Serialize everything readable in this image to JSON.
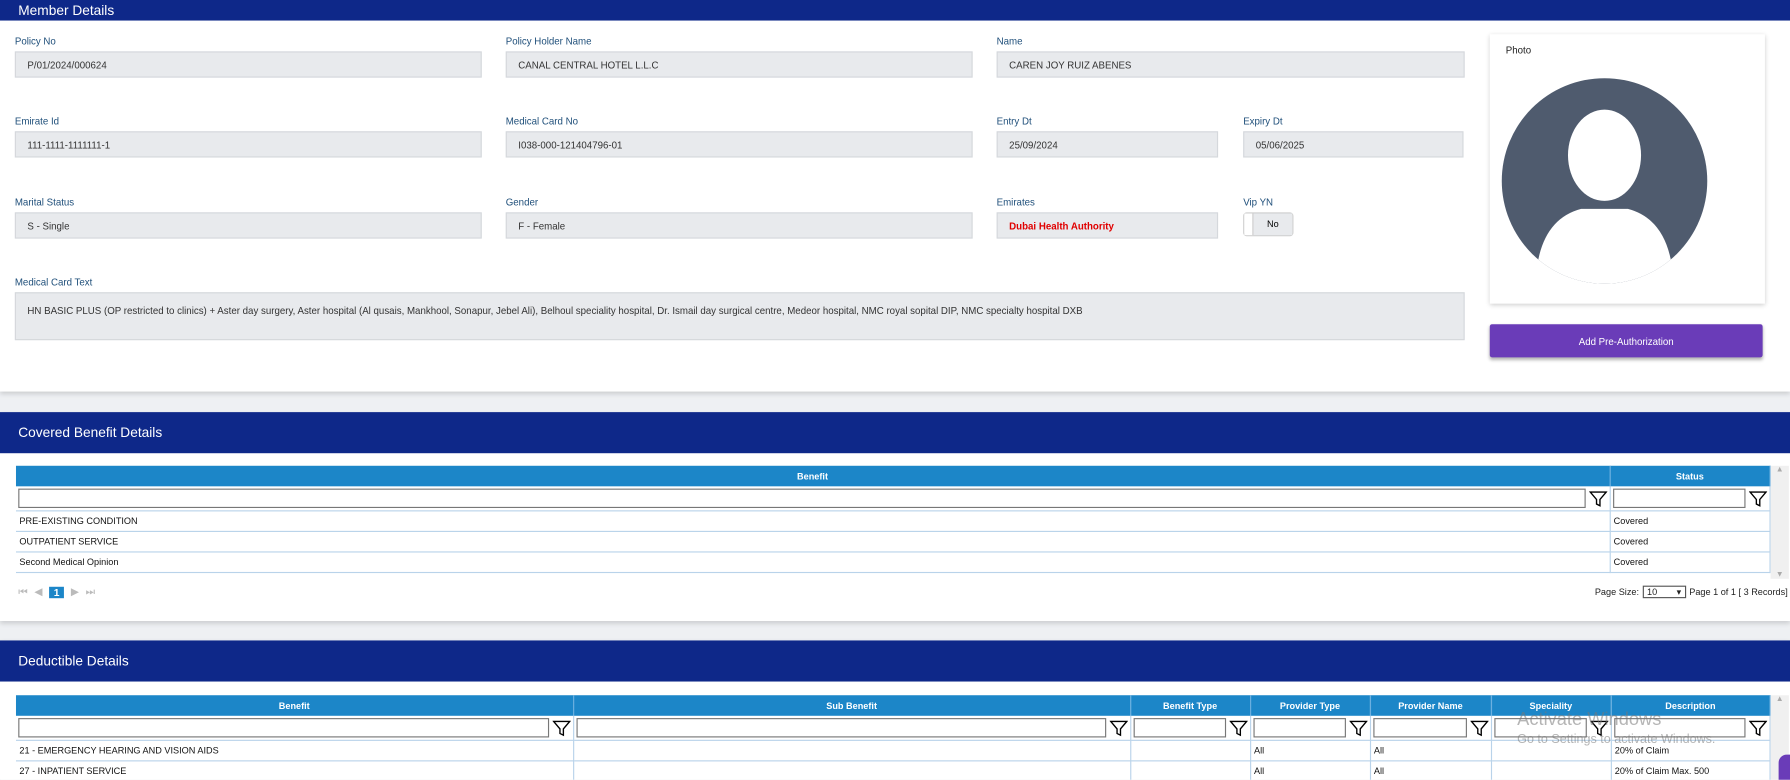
{
  "member": {
    "title": "Member Details",
    "fields": {
      "policy_no": {
        "label": "Policy No",
        "value": "P/01/2024/000624"
      },
      "holder": {
        "label": "Policy Holder Name",
        "value": "CANAL CENTRAL HOTEL L.L.C"
      },
      "name": {
        "label": "Name",
        "value": "CAREN JOY RUIZ ABENES"
      },
      "emirate_id": {
        "label": "Emirate Id",
        "value": "111-1111-1111111-1"
      },
      "card_no": {
        "label": "Medical Card No",
        "value": "I038-000-121404796-01"
      },
      "entry": {
        "label": "Entry Dt",
        "value": "25/09/2024"
      },
      "expiry": {
        "label": "Expiry Dt",
        "value": "05/06/2025"
      },
      "marital": {
        "label": "Marital Status",
        "value": "S - Single"
      },
      "gender": {
        "label": "Gender",
        "value": "F - Female"
      },
      "emirates": {
        "label": "Emirates",
        "value": "Dubai Health Authority"
      },
      "vip": {
        "label": "Vip YN",
        "value": "No"
      },
      "card_text": {
        "label": "Medical Card Text",
        "value": "HN BASIC PLUS (OP restricted to clinics) + Aster day surgery, Aster hospital (Al qusais, Mankhool, Sonapur, Jebel Ali), Belhoul speciality hospital, Dr. Ismail day surgical centre, Medeor hospital, NMC royal sopital DIP,  NMC specialty hospital DXB"
      }
    },
    "photo_label": "Photo",
    "add_button": "Add Pre-Authorization",
    "emirates_color": "#e00000"
  },
  "covered": {
    "title": "Covered Benefit Details",
    "columns": [
      "Benefit",
      "Status"
    ],
    "rows": [
      [
        "PRE-EXISTING CONDITION",
        "Covered"
      ],
      [
        "OUTPATIENT SERVICE",
        "Covered"
      ],
      [
        "Second Medical Opinion",
        "Covered"
      ]
    ],
    "page": "1",
    "page_size_label": "Page Size:",
    "page_size": "10",
    "page_info": "Page 1 of 1 [ 3 Records]"
  },
  "deductible": {
    "title": "Deductible Details",
    "columns": [
      "Benefit",
      "Sub Benefit",
      "Benefit Type",
      "Provider Type",
      "Provider Name",
      "Speciality",
      "Description"
    ],
    "rows": [
      [
        "21 - EMERGENCY HEARING AND VISION AIDS",
        "",
        "",
        "All",
        "All",
        "",
        "20% of Claim"
      ],
      [
        "27 - INPATIENT SERVICE",
        "",
        "",
        "All",
        "All",
        "",
        "20% of Claim Max. 500"
      ]
    ]
  },
  "watermark": {
    "line1": "Activate Windows",
    "line2": "Go to Settings to activate Windows."
  }
}
